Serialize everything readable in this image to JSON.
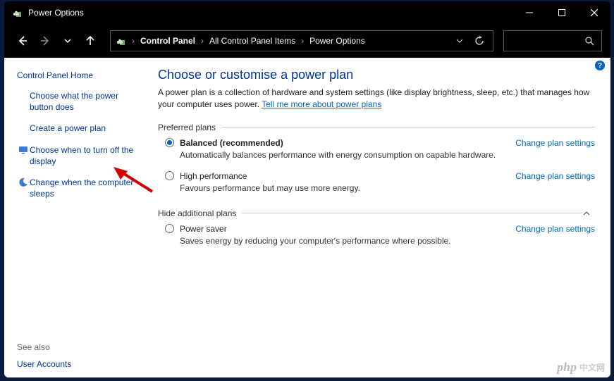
{
  "window": {
    "title": "Power Options"
  },
  "breadcrumb": {
    "items": [
      "Control Panel",
      "All Control Panel Items",
      "Power Options"
    ]
  },
  "sidebar": {
    "home": "Control Panel Home",
    "links": [
      {
        "label": "Choose what the power button does",
        "icon": null
      },
      {
        "label": "Create a power plan",
        "icon": null
      },
      {
        "label": "Choose when to turn off the display",
        "icon": "monitor"
      },
      {
        "label": "Change when the computer sleeps",
        "icon": "moon"
      }
    ],
    "see_also_heading": "See also",
    "see_also": "User Accounts"
  },
  "main": {
    "heading": "Choose or customise a power plan",
    "description": "A power plan is a collection of hardware and system settings (like display brightness, sleep, etc.) that manages how your computer uses power. ",
    "more_link": "Tell me more about power plans",
    "preferred_label": "Preferred plans",
    "additional_label": "Hide additional plans",
    "change_link": "Change plan settings",
    "plans": {
      "preferred": [
        {
          "name": "Balanced (recommended)",
          "desc": "Automatically balances performance with energy consumption on capable hardware.",
          "selected": true
        },
        {
          "name": "High performance",
          "desc": "Favours performance but may use more energy.",
          "selected": false
        }
      ],
      "additional": [
        {
          "name": "Power saver",
          "desc": "Saves energy by reducing your computer's performance where possible.",
          "selected": false
        }
      ]
    }
  },
  "watermark": {
    "brand": "php",
    "text": "中文网"
  }
}
